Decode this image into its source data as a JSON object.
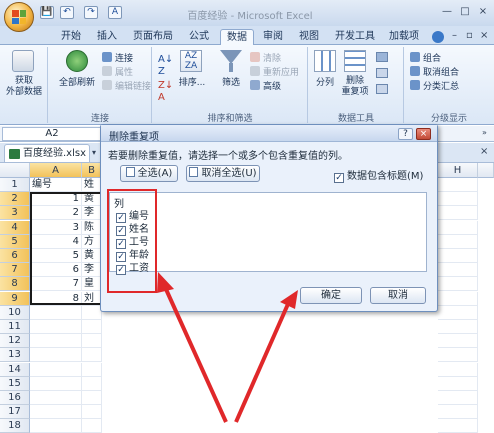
{
  "window": {
    "title": "百度经验 - Microsoft Excel",
    "controls": [
      "—",
      "□",
      "×"
    ]
  },
  "quick_access": [
    "💾",
    "↶",
    "↷",
    "A"
  ],
  "tabs": [
    "开始",
    "插入",
    "页面布局",
    "公式",
    "数据",
    "审阅",
    "视图",
    "开发工具",
    "加载项"
  ],
  "active_tab": "数据",
  "ribbon": {
    "get_external": "获取\n外部数据",
    "refresh_all": "全部刷新",
    "connections": [
      "连接",
      "属性",
      "编辑链接"
    ],
    "sort_big": "排序...",
    "filter": "筛选",
    "filter_small": [
      "清除",
      "重新应用",
      "高级"
    ],
    "split": "分列",
    "remove_dup": "删除\n重复项",
    "outline_small": [
      "组合",
      "取消组合",
      "分类汇总"
    ],
    "groups": [
      "连接",
      "排序和筛选",
      "数据工具",
      "分级显示"
    ]
  },
  "name_box": "A2",
  "workbook_tab": "百度经验.xlsx",
  "sheet": {
    "columns": [
      "A",
      "B",
      "H"
    ],
    "rows": [
      {
        "n": "1",
        "a": "编号",
        "b": "姓"
      },
      {
        "n": "2",
        "a": "1",
        "b": "黄"
      },
      {
        "n": "3",
        "a": "2",
        "b": "李"
      },
      {
        "n": "4",
        "a": "3",
        "b": "陈"
      },
      {
        "n": "5",
        "a": "4",
        "b": "方"
      },
      {
        "n": "6",
        "a": "5",
        "b": "黄"
      },
      {
        "n": "7",
        "a": "6",
        "b": "李"
      },
      {
        "n": "8",
        "a": "7",
        "b": "皇"
      },
      {
        "n": "9",
        "a": "8",
        "b": "刘"
      },
      {
        "n": "10",
        "a": "",
        "b": ""
      },
      {
        "n": "11",
        "a": "",
        "b": ""
      },
      {
        "n": "12",
        "a": "",
        "b": ""
      },
      {
        "n": "13",
        "a": "",
        "b": ""
      },
      {
        "n": "14",
        "a": "",
        "b": ""
      },
      {
        "n": "15",
        "a": "",
        "b": ""
      },
      {
        "n": "16",
        "a": "",
        "b": ""
      },
      {
        "n": "17",
        "a": "",
        "b": ""
      },
      {
        "n": "18",
        "a": "",
        "b": ""
      }
    ]
  },
  "dialog": {
    "title": "删除重复项",
    "message": "若要删除重复值，请选择一个或多个包含重复值的列。",
    "select_all": "全选(A)",
    "unselect_all": "取消全选(U)",
    "header_option": "数据包含标题(M)",
    "header_checked": true,
    "columns_label": "列",
    "columns": [
      "编号",
      "姓名",
      "工号",
      "年龄",
      "工资"
    ],
    "ok": "确定",
    "cancel": "取消",
    "help": "?",
    "close": "×"
  },
  "colors": {
    "annotation": "#e0282a",
    "accent": "#1f4e9a"
  }
}
